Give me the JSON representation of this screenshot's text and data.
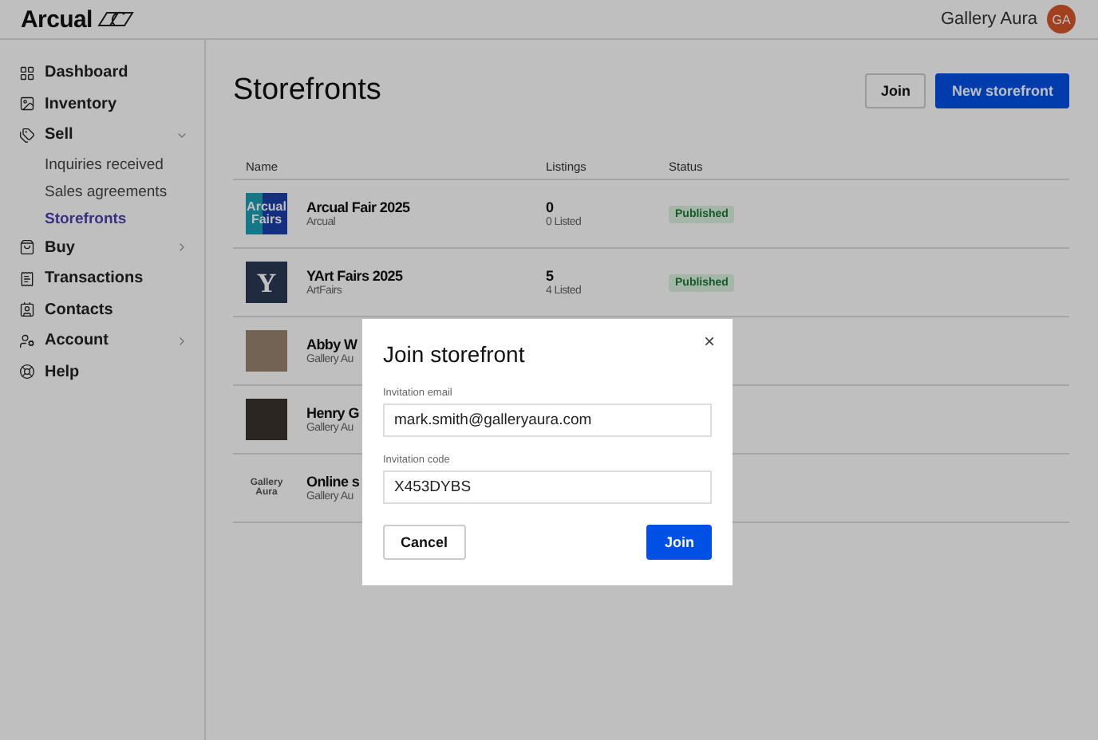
{
  "header": {
    "logo": "Arcual",
    "account_name": "Gallery Aura",
    "avatar_initials": "GA"
  },
  "sidebar": {
    "items": [
      {
        "label": "Dashboard"
      },
      {
        "label": "Inventory"
      },
      {
        "label": "Sell",
        "expanded": true,
        "children": [
          {
            "label": "Inquiries received",
            "selected": false
          },
          {
            "label": "Sales agreements",
            "selected": false
          },
          {
            "label": "Storefronts",
            "selected": true
          }
        ]
      },
      {
        "label": "Buy",
        "expanded": false
      },
      {
        "label": "Transactions"
      },
      {
        "label": "Contacts"
      },
      {
        "label": "Account",
        "expanded": false
      },
      {
        "label": "Help"
      }
    ]
  },
  "page": {
    "title": "Storefronts",
    "buttons": [
      {
        "label": "Join",
        "kind": "secondary"
      },
      {
        "label": "New storefront",
        "kind": "primary"
      }
    ]
  },
  "table": {
    "columns": [
      "Name",
      "Listings",
      "Status"
    ],
    "rows": [
      {
        "thumb": {
          "kind": "tile",
          "text": "Arcual Fairs"
        },
        "name": "Arcual Fair 2025",
        "owner": "Arcual",
        "listings": "0",
        "listed": "0 Listed",
        "status": "Published"
      },
      {
        "thumb": {
          "kind": "tile-dark",
          "text": "Y"
        },
        "name": "YArt Fairs 2025",
        "owner": "ArtFairs",
        "listings": "5",
        "listed": "4 Listed",
        "status": "Published"
      },
      {
        "thumb": {
          "kind": "photo"
        },
        "name": "Abby W",
        "owner": "Gallery Au"
      },
      {
        "thumb": {
          "kind": "photo-dark"
        },
        "name": "Henry G",
        "owner": "Gallery Au"
      },
      {
        "thumb": {
          "kind": "wordmark",
          "text": "Gallery Aura"
        },
        "name": "Online s",
        "owner": "Gallery Au"
      }
    ]
  },
  "dialog": {
    "title": "Join storefront",
    "close": "×",
    "fields": [
      {
        "label": "Invitation email",
        "value": "mark.smith@galleryaura.com"
      },
      {
        "label": "Invitation code",
        "value": "X453DYBS"
      }
    ],
    "buttons": [
      {
        "label": "Cancel",
        "kind": "secondary"
      },
      {
        "label": "Join",
        "kind": "primary"
      }
    ]
  }
}
